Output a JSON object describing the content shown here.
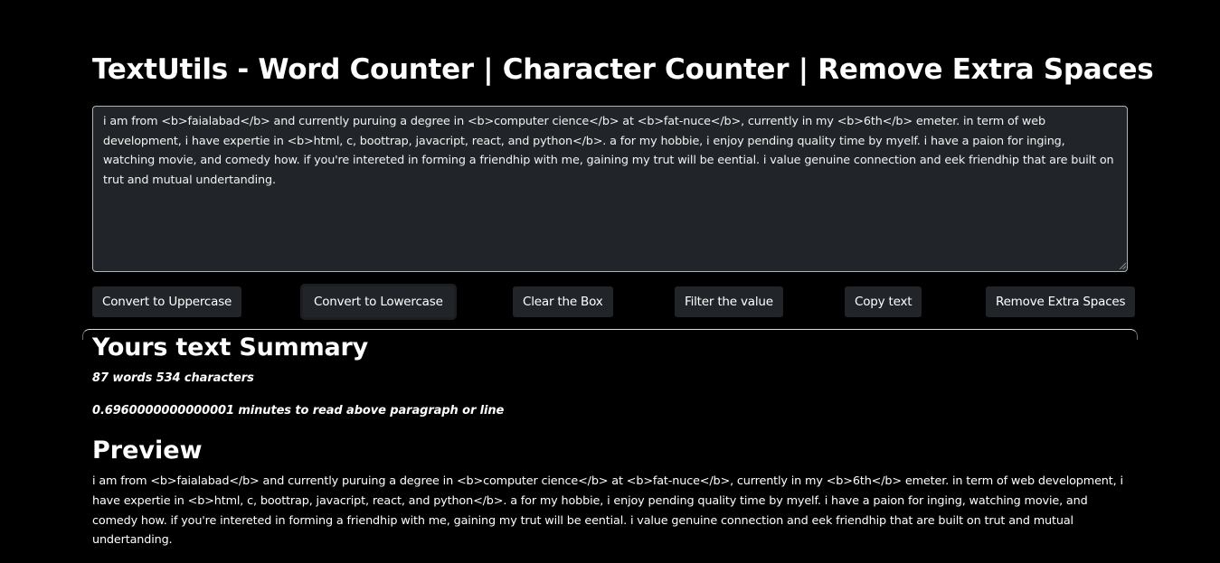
{
  "header": {
    "title": "TextUtils - Word Counter | Character Counter | Remove Extra Spaces"
  },
  "editor": {
    "text": "i am from <b>faialabad</b> and currently puruing a degree in <b>computer cience</b> at <b>fat-nuce</b>, currently in my <b>6th</b> emeter. in term of web development, i have expertie in <b>html, c, boottrap, javacript, react, and python</b>. a for my hobbie, i enjoy pending quality time by myelf. i have a paion for inging, watching movie, and comedy how. if you're intereted in forming a friendhip with me, gaining my trut will be eential. i value genuine connection and eek friendhip that are built on trut and mutual undertanding."
  },
  "buttons": {
    "uppercase": "Convert to Uppercase",
    "lowercase": "Convert to Lowercase",
    "clear": "Clear the Box",
    "filter": "Filter the value",
    "copy": "Copy text",
    "remove_spaces": "Remove Extra Spaces"
  },
  "summary": {
    "title": "Yours text Summary",
    "counts": "87 words 534 characters",
    "read_time": "0.6960000000000001 minutes to read above paragraph or line"
  },
  "preview": {
    "title": "Preview",
    "text": "i am from <b>faialabad</b> and currently puruing a degree in <b>computer cience</b> at <b>fat-nuce</b>, currently in my <b>6th</b> emeter. in term of web development, i have expertie in <b>html, c, boottrap, javacript, react, and python</b>. a for my hobbie, i enjoy pending quality time by myelf. i have a paion for inging, watching movie, and comedy how. if you're intereted in forming a friendhip with me, gaining my trut will be eential. i value genuine connection and eek friendhip that are built on trut and mutual undertanding."
  },
  "colors": {
    "background": "#000000",
    "control_bg": "#212529",
    "text": "#ffffff"
  }
}
